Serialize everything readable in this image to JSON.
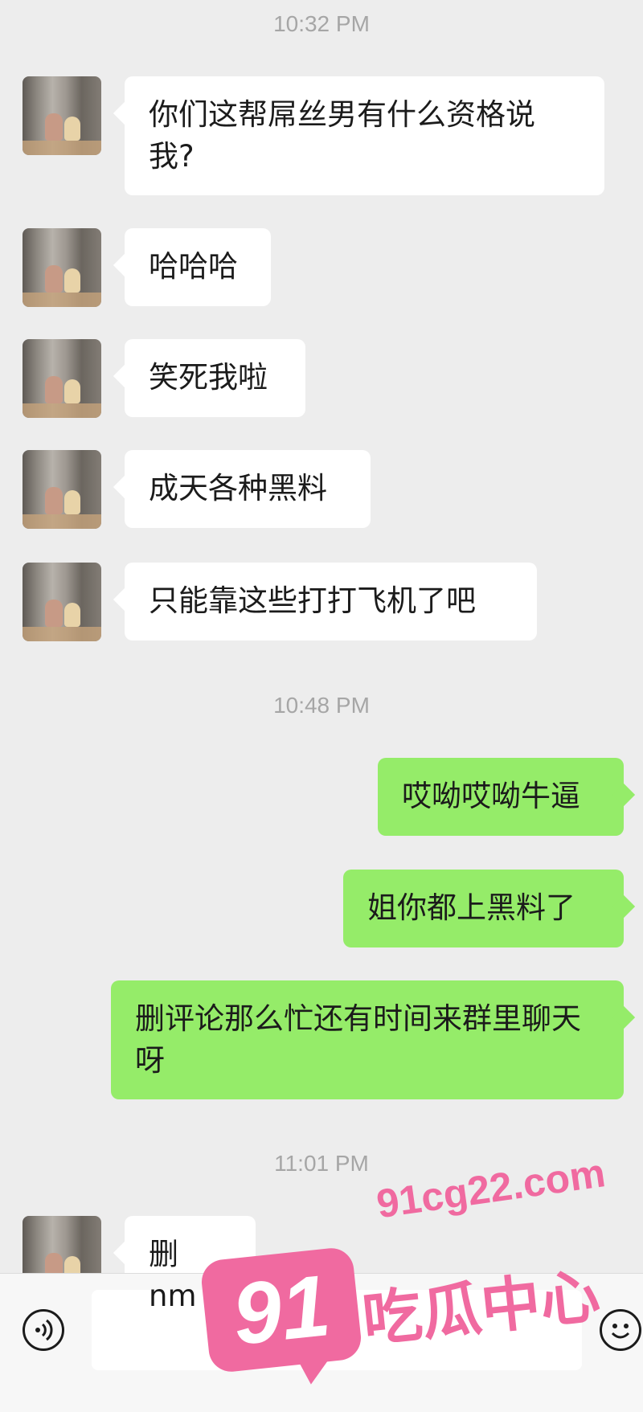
{
  "chat": {
    "timestamps": [
      "10:32 PM",
      "10:48 PM",
      "11:01 PM"
    ],
    "messages": [
      {
        "side": "left",
        "text": "你们这帮屌丝男有什么资格说我?"
      },
      {
        "side": "left",
        "text": "哈哈哈"
      },
      {
        "side": "left",
        "text": "笑死我啦"
      },
      {
        "side": "left",
        "text": "成天各种黑料"
      },
      {
        "side": "left",
        "text": "只能靠这些打打飞机了吧"
      },
      {
        "side": "right",
        "text": "哎呦哎呦牛逼"
      },
      {
        "side": "right",
        "text": "姐你都上黑料了"
      },
      {
        "side": "right",
        "text": "删评论那么忙还有时间来群里聊天呀"
      },
      {
        "side": "left",
        "text": "删 nm"
      }
    ]
  },
  "colors": {
    "background": "#ededed",
    "incoming_bubble": "#ffffff",
    "outgoing_bubble": "#95ec69",
    "watermark": "#f06aa0"
  },
  "input_bar": {
    "voice_icon": "voice-icon",
    "emoji_icon": "emoji-icon",
    "placeholder": ""
  },
  "watermark": {
    "url": "91cg22.com",
    "badge_number": "91",
    "name": "吃瓜中心"
  }
}
